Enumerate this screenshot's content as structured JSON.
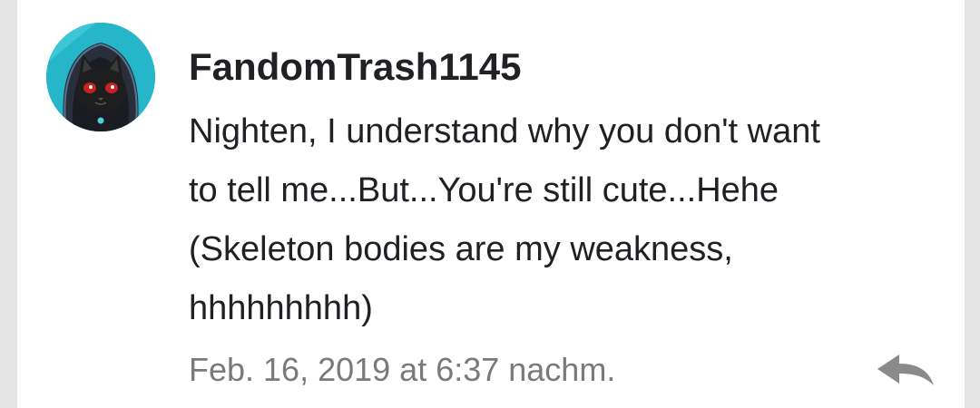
{
  "comment": {
    "avatar_icon": "black-cat-hood-avatar",
    "username": "FandomTrash1145",
    "message": "Nighten, I understand why you don't want\nto tell me...But...You're still cute...Hehe\n(Skeleton bodies are my weakness,\nhhhhhhhhh)",
    "timestamp": "Feb. 16, 2019 at 6:37 nachm.",
    "reply_icon": "reply-arrow-icon"
  },
  "colors": {
    "text": "#202124",
    "meta": "#7a7a7a",
    "avatar_bg": "#25b6c9",
    "reply_icon": "#8a8a8a"
  }
}
